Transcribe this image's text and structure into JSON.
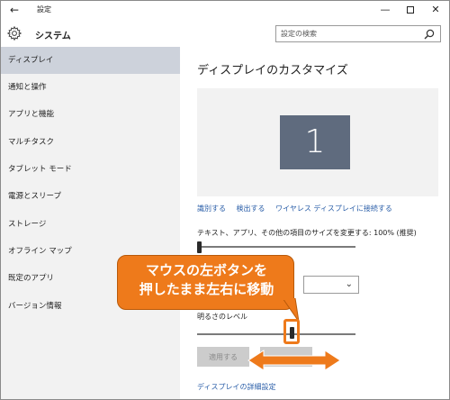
{
  "window": {
    "title": "設定",
    "minimize_glyph": "—",
    "close_glyph": "✕",
    "back_glyph": "←"
  },
  "header": {
    "title": "システム",
    "search_placeholder": "設定の検索"
  },
  "sidebar": {
    "items": [
      {
        "label": "ディスプレイ",
        "active": true
      },
      {
        "label": "通知と操作"
      },
      {
        "label": "アプリと機能"
      },
      {
        "label": "マルチタスク"
      },
      {
        "label": "タブレット モード"
      },
      {
        "label": "電源とスリープ"
      },
      {
        "label": "ストレージ"
      },
      {
        "label": "オフライン マップ"
      },
      {
        "label": "既定のアプリ"
      },
      {
        "label": "バージョン情報"
      }
    ]
  },
  "main": {
    "page_title": "ディスプレイのカスタマイズ",
    "monitor_number": "1",
    "links": {
      "identify": "識別する",
      "detect": "検出する",
      "wireless": "ワイヤレス ディスプレイに接続する"
    },
    "scale_label": "テキスト、アプリ、その他の項目のサイズを変更する: 100% (推奨)",
    "scale_level": 0.0,
    "brightness_label": "明るさのレベル",
    "brightness_level": 0.6,
    "apply_button": "適用する",
    "advanced_link": "ディスプレイの詳細設定"
  },
  "overlay": {
    "callout_text": "マウスの左ボタンを\n押したまま左右に移動",
    "accent_color": "#ee7a1b"
  },
  "colors": {
    "sidebar_bg": "#f2f2f2",
    "sidebar_active": "#cdd2db",
    "link": "#2a5ea8",
    "monitor": "#5f6b7e"
  }
}
